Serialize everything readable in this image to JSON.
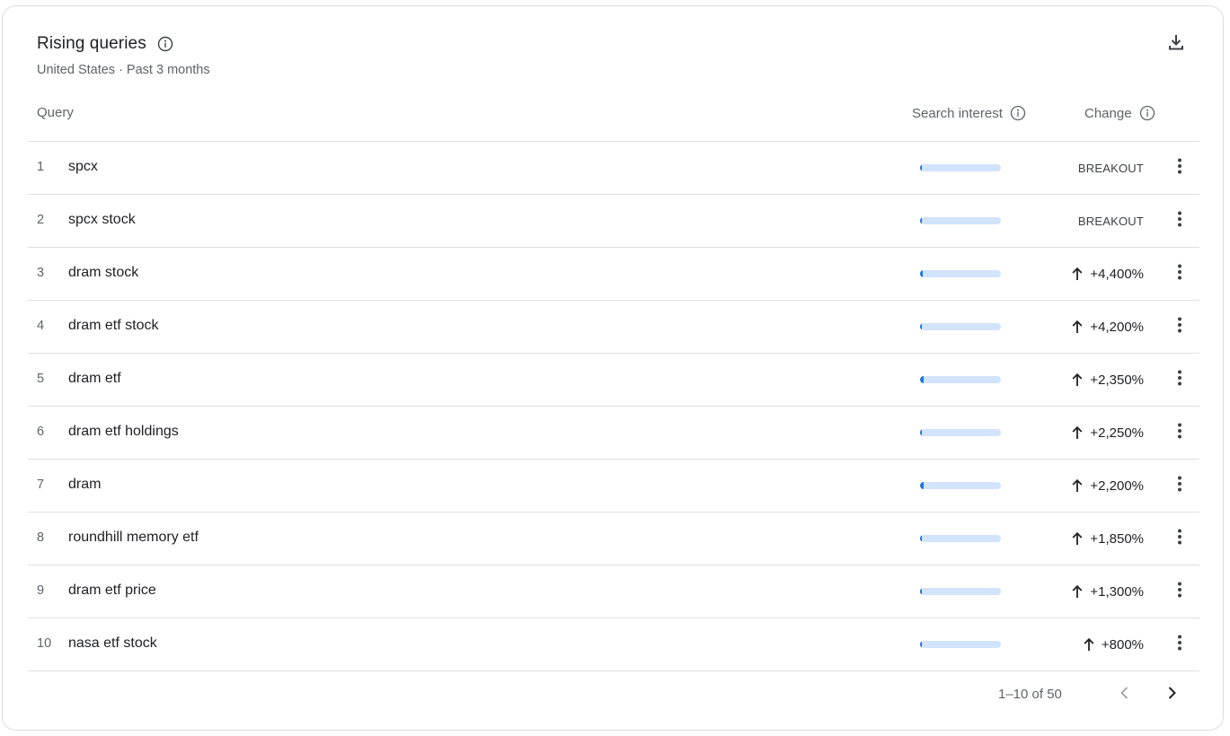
{
  "header": {
    "title": "Rising queries",
    "subtitle": "United States · Past 3 months",
    "title_info_icon": "info-icon",
    "download_icon": "download-icon"
  },
  "columns": {
    "query": "Query",
    "search_interest": "Search interest",
    "change": "Change"
  },
  "rows": [
    {
      "rank": "1",
      "query": "spcx",
      "interest": 0.02,
      "change": "BREAKOUT",
      "breakout": true
    },
    {
      "rank": "2",
      "query": "spcx stock",
      "interest": 0.02,
      "change": "BREAKOUT",
      "breakout": true
    },
    {
      "rank": "3",
      "query": "dram stock",
      "interest": 0.03,
      "change": "+4,400%",
      "breakout": false
    },
    {
      "rank": "4",
      "query": "dram etf stock",
      "interest": 0.02,
      "change": "+4,200%",
      "breakout": false
    },
    {
      "rank": "5",
      "query": "dram etf",
      "interest": 0.04,
      "change": "+2,350%",
      "breakout": false
    },
    {
      "rank": "6",
      "query": "dram etf holdings",
      "interest": 0.02,
      "change": "+2,250%",
      "breakout": false
    },
    {
      "rank": "7",
      "query": "dram",
      "interest": 0.04,
      "change": "+2,200%",
      "breakout": false
    },
    {
      "rank": "8",
      "query": "roundhill memory etf",
      "interest": 0.02,
      "change": "+1,850%",
      "breakout": false
    },
    {
      "rank": "9",
      "query": "dram etf price",
      "interest": 0.02,
      "change": "+1,300%",
      "breakout": false
    },
    {
      "rank": "10",
      "query": "nasa etf stock",
      "interest": 0.02,
      "change": "+800%",
      "breakout": false
    }
  ],
  "pagination": {
    "label": "1–10 of 50",
    "prev_icon": "chevron-left-icon",
    "next_icon": "chevron-right-icon"
  },
  "colors": {
    "accent": "#1a73e8",
    "bar_track": "#d2e3fc",
    "text_primary": "#202124",
    "text_secondary": "#5f6368",
    "divider": "#e0e0e0"
  }
}
